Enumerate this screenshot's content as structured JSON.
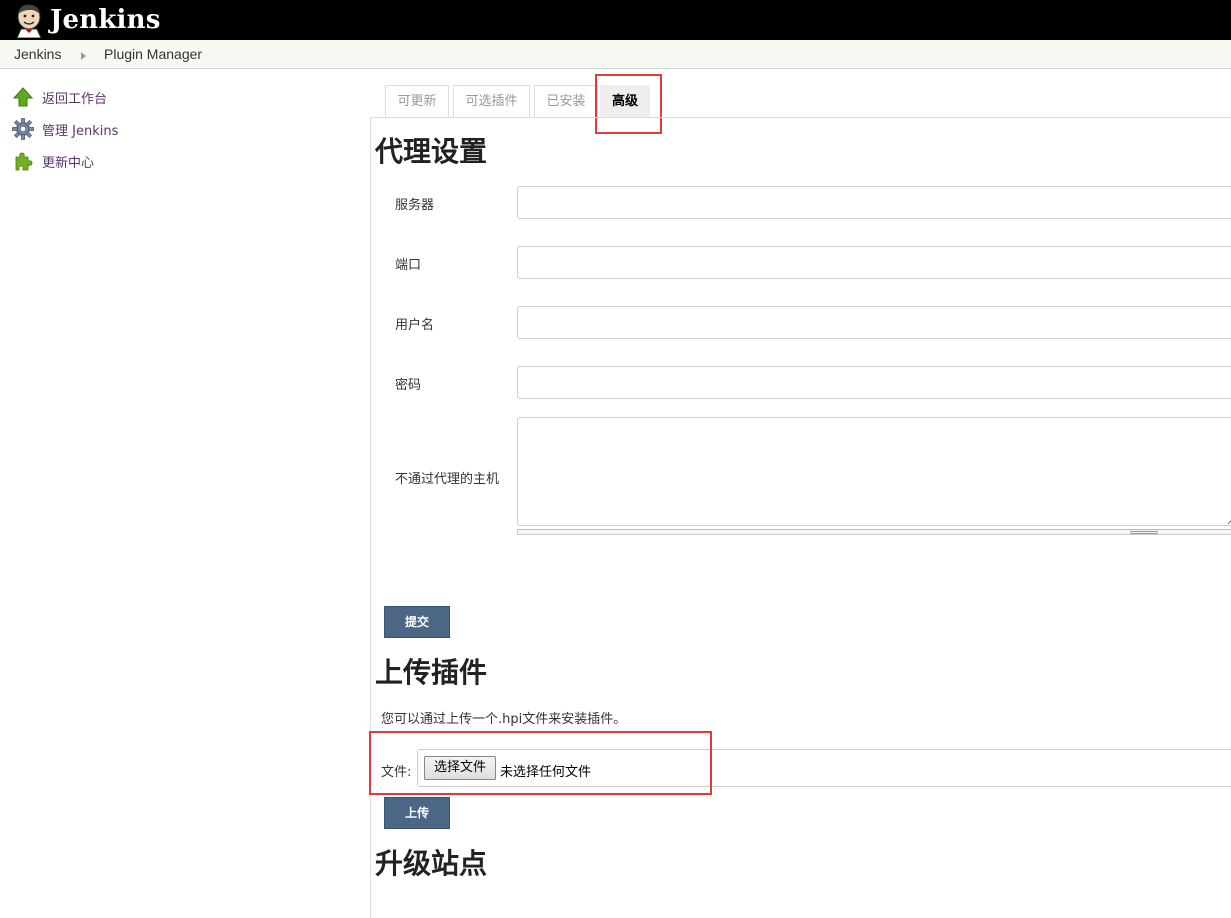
{
  "header": {
    "logo_text": "Jenkins"
  },
  "breadcrumb": {
    "items": [
      "Jenkins",
      "Plugin Manager"
    ]
  },
  "sidebar": {
    "items": [
      {
        "label": "返回工作台",
        "icon": "up-arrow-icon"
      },
      {
        "label": "管理 Jenkins",
        "icon": "gear-icon"
      },
      {
        "label": "更新中心",
        "icon": "puzzle-icon"
      }
    ]
  },
  "tabs": [
    {
      "label": "可更新",
      "active": false
    },
    {
      "label": "可选插件",
      "active": false
    },
    {
      "label": "已安装",
      "active": false
    },
    {
      "label": "高级",
      "active": true
    }
  ],
  "proxy": {
    "heading": "代理设置",
    "server_label": "服务器",
    "port_label": "端口",
    "username_label": "用户名",
    "password_label": "密码",
    "no_proxy_label": "不通过代理的主机",
    "server_value": "",
    "port_value": "",
    "username_value": "",
    "password_value": "",
    "no_proxy_value": "",
    "submit_label": "提交"
  },
  "upload": {
    "heading": "上传插件",
    "description": "您可以通过上传一个.hpi文件来安装插件。",
    "file_label": "文件:",
    "choose_button": "选择文件",
    "file_status": "未选择任何文件",
    "upload_label": "上传"
  },
  "update_site": {
    "heading": "升级站点"
  },
  "colors": {
    "header_bg": "#000000",
    "button_bg": "#4b6785",
    "highlight": "#e03a3a",
    "breadcrumb_bg": "#f6faf2"
  }
}
